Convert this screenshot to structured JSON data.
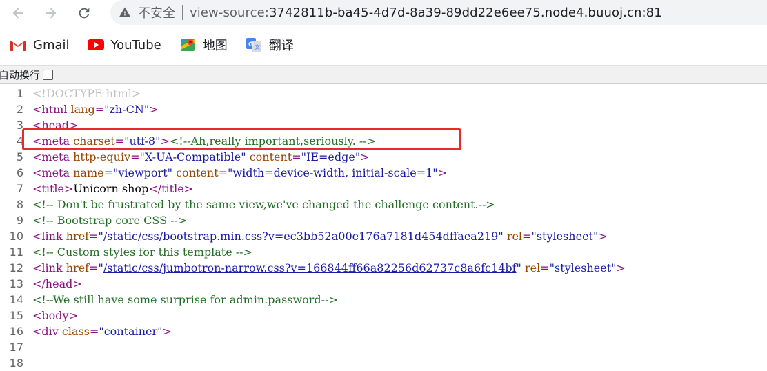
{
  "browser": {
    "security_label": "不安全",
    "url_scheme": "view-source:",
    "url_host": "3742811b-ba45-4d7d-8a39-89dd22e6ee75.node4.buuoj.cn:81"
  },
  "bookmarks": [
    {
      "label": "Gmail",
      "icon": "gmail-icon"
    },
    {
      "label": "YouTube",
      "icon": "youtube-icon"
    },
    {
      "label": "地图",
      "icon": "maps-icon"
    },
    {
      "label": "翻译",
      "icon": "translate-icon"
    }
  ],
  "wrap": {
    "label": "自动换行",
    "checked": false
  },
  "source_lines": [
    {
      "n": "1",
      "t": "<!DOCTYPE html>"
    },
    {
      "n": "2",
      "t": "<html lang=\"zh-CN\">"
    },
    {
      "n": "3",
      "t": "<head>"
    },
    {
      "n": "4",
      "t": "<meta charset=\"utf-8\"><!--Ah,really important,seriously. -->"
    },
    {
      "n": "5",
      "t": "<meta http-equiv=\"X-UA-Compatible\" content=\"IE=edge\">"
    },
    {
      "n": "6",
      "t": "<meta name=\"viewport\" content=\"width=device-width, initial-scale=1\">"
    },
    {
      "n": "7",
      "t": "<title>Unicorn shop</title>"
    },
    {
      "n": "8",
      "t": "<!-- Don't be frustrated by the same view,we've changed the challenge content.-->"
    },
    {
      "n": "9",
      "t": "<!-- Bootstrap core CSS -->"
    },
    {
      "n": "10",
      "t": "<link href=\"/static/css/bootstrap.min.css?v=ec3bb52a00e176a7181d454dffaea219\" rel=\"stylesheet\">"
    },
    {
      "n": "11",
      "t": "<!-- Custom styles for this template -->"
    },
    {
      "n": "12",
      "t": "<link href=\"/static/css/jumbotron-narrow.css?v=166844ff66a82256d62737c8a6fc14bf\" rel=\"stylesheet\">"
    },
    {
      "n": "13",
      "t": "</head>"
    },
    {
      "n": "14",
      "t": "<!--We still have some surprise for admin.password-->"
    },
    {
      "n": "15",
      "t": "<body>"
    },
    {
      "n": "16",
      "t": "<div class=\"container\">"
    },
    {
      "n": "17",
      "t": ""
    },
    {
      "n": "18",
      "t": ""
    }
  ],
  "colors": {
    "highlight_box": "#e52b2b",
    "tag": "#881280",
    "attribute": "#994500",
    "value": "#1a1aa6",
    "comment": "#236e25"
  }
}
